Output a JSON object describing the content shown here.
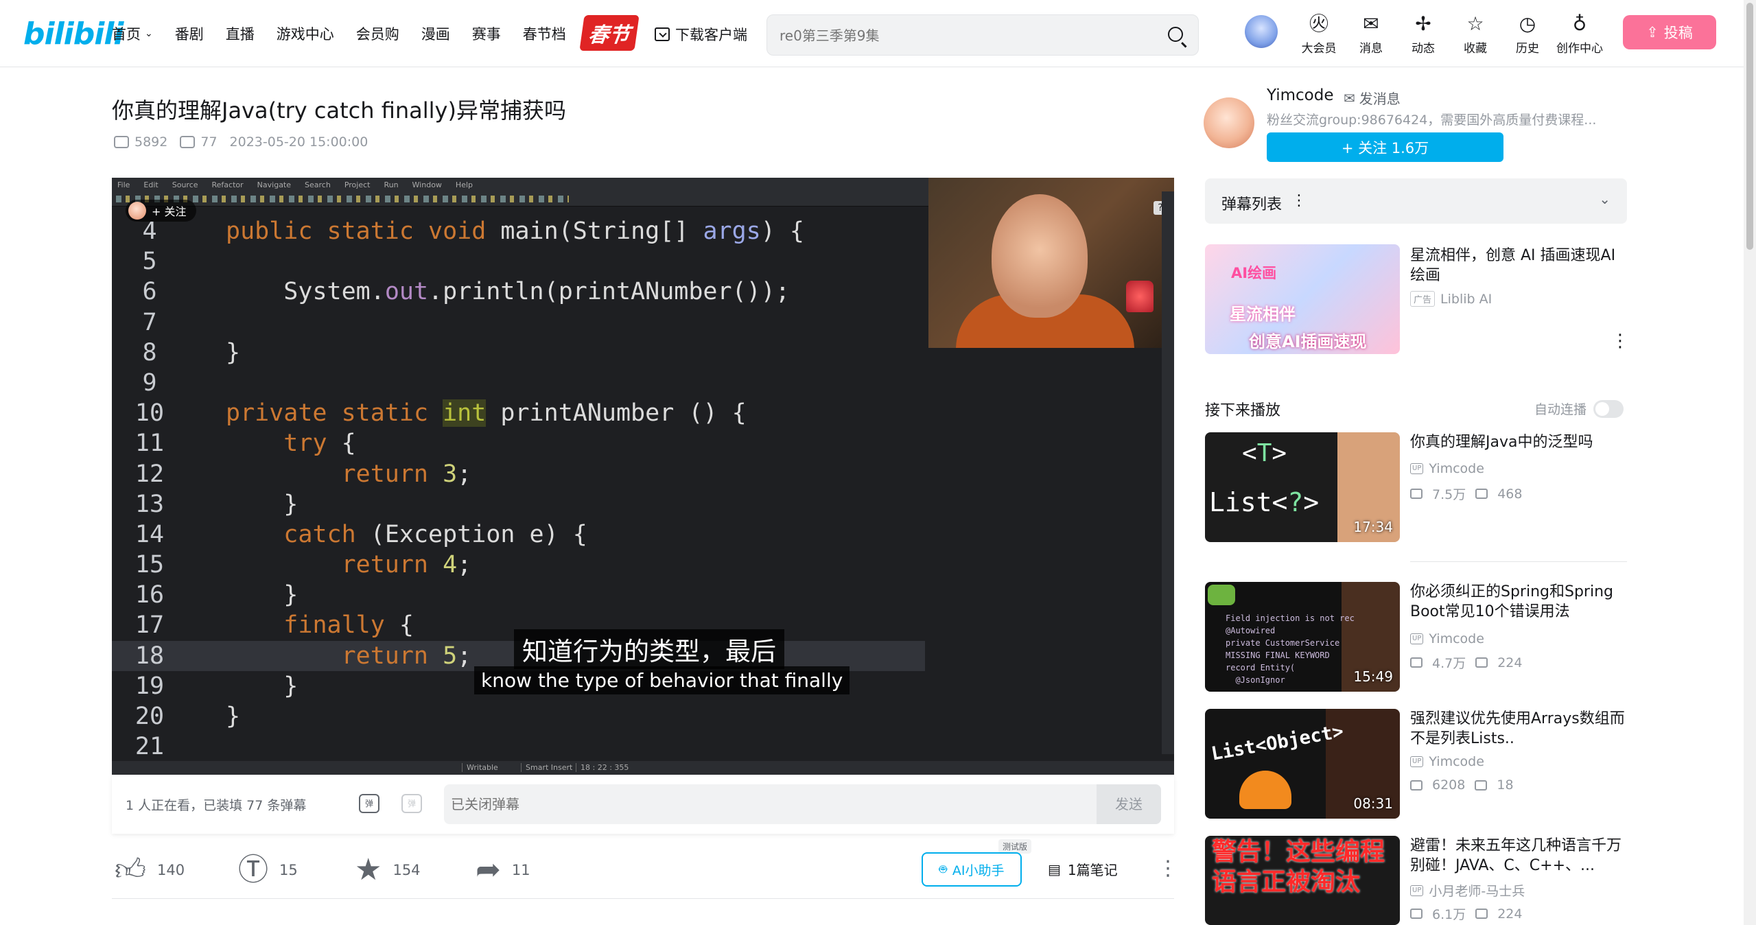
{
  "header": {
    "logo": "bilibili",
    "nav": [
      "首页",
      "番剧",
      "直播",
      "游戏中心",
      "会员购",
      "漫画",
      "赛事",
      "春节档"
    ],
    "spring_badge": "春节",
    "download": "下载客户端",
    "search_placeholder": "re0第三季第9集",
    "icons": [
      {
        "label": "大会员",
        "icon": "vip-icon"
      },
      {
        "label": "消息",
        "icon": "message-icon"
      },
      {
        "label": "动态",
        "icon": "feed-icon"
      },
      {
        "label": "收藏",
        "icon": "star-icon"
      },
      {
        "label": "历史",
        "icon": "history-icon"
      },
      {
        "label": "创作中心",
        "icon": "creator-icon"
      }
    ],
    "upload": "投稿"
  },
  "video": {
    "title": "你真的理解Java(try catch finally)异常捕获吗",
    "views": "5892",
    "danmaku": "77",
    "date": "2023-05-20 15:00:00"
  },
  "player": {
    "ide_menu": [
      "File",
      "Edit",
      "Source",
      "Refactor",
      "Navigate",
      "Search",
      "Project",
      "Run",
      "Window",
      "Help"
    ],
    "follow_overlay": "+ 关注",
    "code_lines": [
      {
        "n": "4",
        "t": "public static void main(String[] args) {"
      },
      {
        "n": "5",
        "t": ""
      },
      {
        "n": "6",
        "t": "    System.out.println(printANumber());"
      },
      {
        "n": "7",
        "t": ""
      },
      {
        "n": "8",
        "t": "}"
      },
      {
        "n": "9",
        "t": ""
      },
      {
        "n": "10",
        "t": "private static int printANumber () {"
      },
      {
        "n": "11",
        "t": "    try {"
      },
      {
        "n": "12",
        "t": "        return 3;"
      },
      {
        "n": "13",
        "t": "    }"
      },
      {
        "n": "14",
        "t": "    catch (Exception e) {"
      },
      {
        "n": "15",
        "t": "        return 4;"
      },
      {
        "n": "16",
        "t": "    }"
      },
      {
        "n": "17",
        "t": "    finally {"
      },
      {
        "n": "18",
        "t": "        return 5;"
      },
      {
        "n": "19",
        "t": "    }"
      },
      {
        "n": "20",
        "t": "}"
      },
      {
        "n": "21",
        "t": ""
      }
    ],
    "subtitle_cn": "知道行为的类型，最后",
    "subtitle_en": "know the type of behavior that finally",
    "status": [
      "Writable",
      "Smart Insert",
      "18 : 22 : 355"
    ]
  },
  "danmaku_bar": {
    "count_text": "1 人正在看，已装填 77 条弹幕",
    "input_placeholder": "已关闭弹幕",
    "send": "发送"
  },
  "actions": {
    "like": "140",
    "coin": "15",
    "favorite": "154",
    "share": "11",
    "ai_tag": "测试版",
    "ai_label": "AI小助手",
    "notes": "1篇笔记"
  },
  "uploader": {
    "name": "Yimcode",
    "message": "发消息",
    "desc": "粉丝交流group:98676424，需要国外高质量付费课程...",
    "follow": "+ 关注 1.6万"
  },
  "danmaku_list": "弹幕列表",
  "ad": {
    "title": "星流相伴，创意 AI 插画速现AI绘画",
    "tag": "广告",
    "source": "Liblib AI",
    "thumb_t1": "AI绘画",
    "thumb_t2": "星流相伴",
    "thumb_t3": "创意AI插画速现"
  },
  "next": {
    "header": "接下来播放",
    "autoplay": "自动连播"
  },
  "recommendations": [
    {
      "title": "你真的理解Java中的泛型吗",
      "author": "Yimcode",
      "views": "7.5万",
      "danmaku": "468",
      "duration": "17:34",
      "thumb_text": "<T>\nList<?>"
    },
    {
      "title": "你必须纠正的Spring和Spring Boot常见10个错误用法",
      "author": "Yimcode",
      "views": "4.7万",
      "danmaku": "224",
      "duration": "15:49"
    },
    {
      "title": "强烈建议优先使用Arrays数组而不是列表Lists..",
      "author": "Yimcode",
      "views": "6208",
      "danmaku": "18",
      "duration": "08:31",
      "thumb_text": "List<Object>"
    },
    {
      "title": "避雷！未来五年这几种语言千万别碰！JAVA、C、C++、...",
      "author": "小月老师-马士兵",
      "views": "6.1万",
      "danmaku": "224",
      "duration": "",
      "thumb_text": "警告！这些编程语言正被淘汰"
    }
  ]
}
